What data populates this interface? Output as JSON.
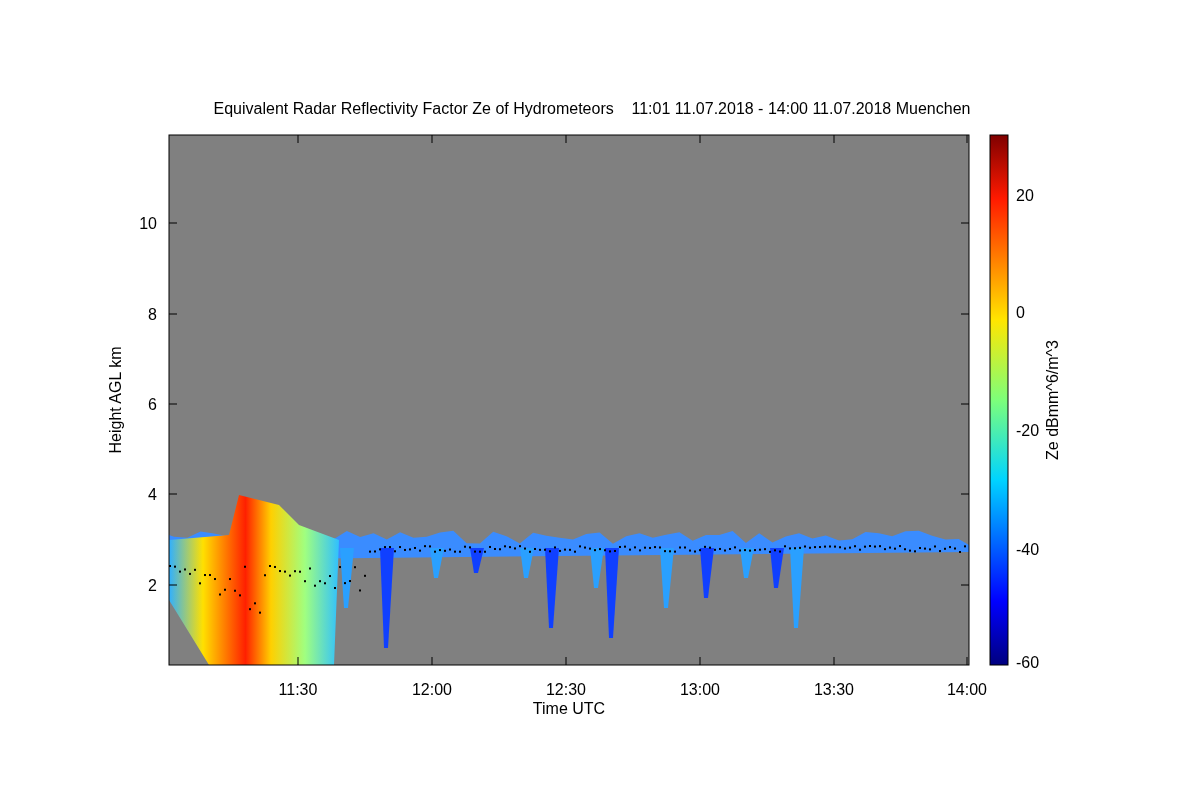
{
  "title": "Equivalent Radar Reflectivity Factor Ze of Hydrometeors    11:01 11.07.2018 - 14:00 11.07.2018 Muenchen",
  "y_axis": {
    "label": "Height AGL km",
    "ticks": [
      "10",
      "8",
      "6",
      "4",
      "2"
    ]
  },
  "x_axis": {
    "label": "Time UTC",
    "ticks": [
      "11:30",
      "12:00",
      "12:30",
      "13:00",
      "13:30",
      "14:00"
    ]
  },
  "colorbar": {
    "label": "Ze dBmm^6/m^3",
    "ticks": [
      "20",
      "0",
      "-20",
      "-40",
      "-60"
    ]
  }
}
